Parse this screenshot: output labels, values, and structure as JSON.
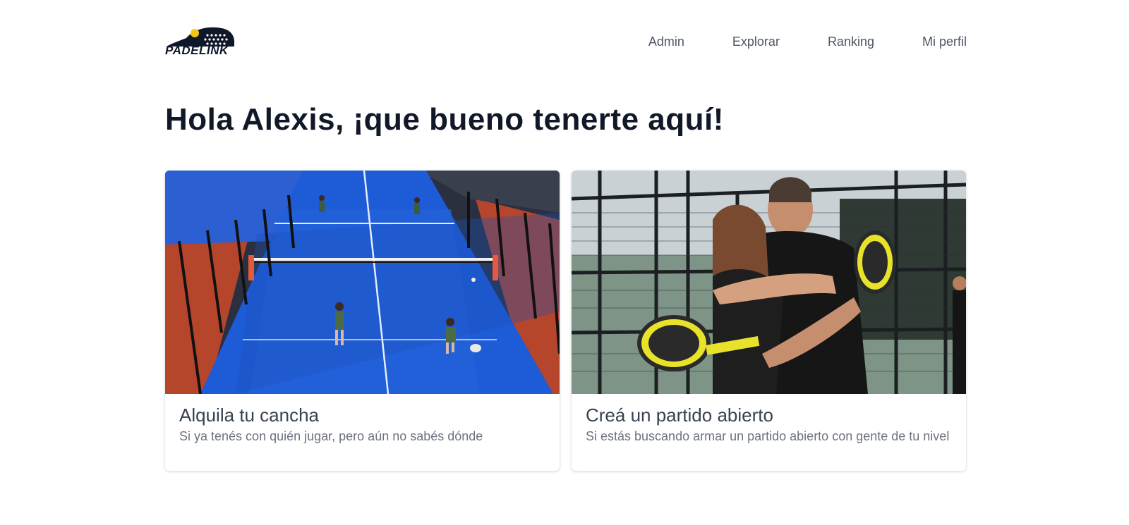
{
  "brand": {
    "name": "PADELINK"
  },
  "nav": {
    "items": [
      {
        "label": "Admin"
      },
      {
        "label": "Explorar"
      },
      {
        "label": "Ranking"
      },
      {
        "label": "Mi perfil"
      }
    ]
  },
  "greeting": "Hola Alexis, ¡que bueno tenerte aquí!",
  "cards": [
    {
      "title": "Alquila tu cancha",
      "description": "Si ya tenés con quién jugar, pero aún no sabés dónde",
      "image": "padel-court-aerial"
    },
    {
      "title": "Creá un partido abierto",
      "description": "Si estás buscando armar un partido abierto con gente de tu nivel",
      "image": "players-hugging"
    }
  ],
  "colors": {
    "text_primary": "#111827",
    "text_nav": "#4b5563",
    "text_muted": "#6b7280",
    "court_blue": "#1e5bd6",
    "court_red": "#b5452b",
    "racket_yellow": "#e8e22a"
  }
}
